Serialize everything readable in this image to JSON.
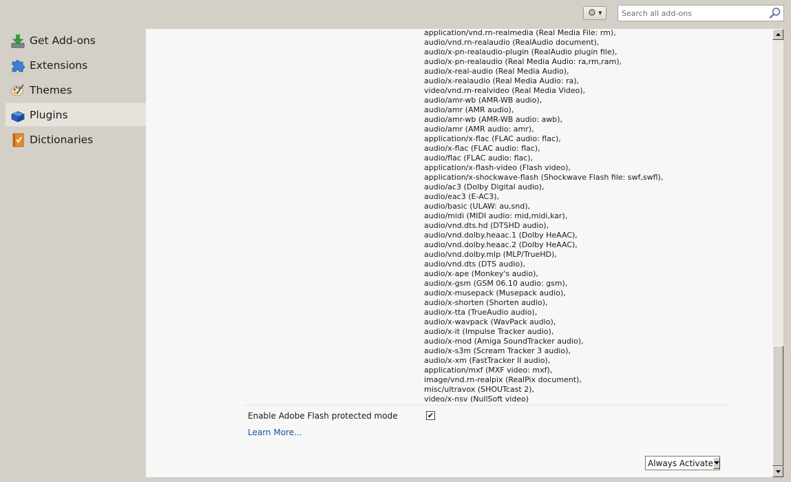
{
  "toolbar": {
    "gear_icon": "gear-icon",
    "search": {
      "placeholder": "Search all add-ons",
      "value": ""
    }
  },
  "sidebar": {
    "items": [
      {
        "label": "Get Add-ons",
        "icon": "get-addons-icon",
        "selected": false
      },
      {
        "label": "Extensions",
        "icon": "puzzle-piece-icon",
        "selected": false
      },
      {
        "label": "Themes",
        "icon": "paintbrush-icon",
        "selected": false
      },
      {
        "label": "Plugins",
        "icon": "plugin-block-icon",
        "selected": true
      },
      {
        "label": "Dictionaries",
        "icon": "dictionary-book-icon",
        "selected": false
      }
    ]
  },
  "plugin_detail": {
    "mime_types": [
      "application/vnd.rn-realmedia (Real Media File: rm),",
      "audio/vnd.rn-realaudio (RealAudio document),",
      "audio/x-pn-realaudio-plugin (RealAudio plugin file),",
      "audio/x-pn-realaudio (Real Media Audio: ra,rm,ram),",
      "audio/x-real-audio (Real Media Audio),",
      "audio/x-realaudio (Real Media Audio: ra),",
      "video/vnd.rn-realvideo (Real Media Video),",
      "audio/amr-wb (AMR-WB audio),",
      "audio/amr (AMR audio),",
      "audio/amr-wb (AMR-WB audio: awb),",
      "audio/amr (AMR audio: amr),",
      "application/x-flac (FLAC audio: flac),",
      "audio/x-flac (FLAC audio: flac),",
      "audio/flac (FLAC audio: flac),",
      "application/x-flash-video (Flash video),",
      "application/x-shockwave-flash (Shockwave Flash file: swf,swfl),",
      "audio/ac3 (Dolby Digital audio),",
      "audio/eac3 (E-AC3),",
      "audio/basic (ULAW: au,snd),",
      "audio/midi (MIDI audio: mid,midi,kar),",
      "audio/vnd.dts.hd (DTSHD audio),",
      "audio/vnd.dolby.heaac.1 (Dolby HeAAC),",
      "audio/vnd.dolby.heaac.2 (Dolby HeAAC),",
      "audio/vnd.dolby.mlp (MLP/TrueHD),",
      "audio/vnd.dts (DTS audio),",
      "audio/x-ape (Monkey's audio),",
      "audio/x-gsm (GSM 06.10 audio: gsm),",
      "audio/x-musepack (Musepack audio),",
      "audio/x-shorten (Shorten audio),",
      "audio/x-tta (TrueAudio audio),",
      "audio/x-wavpack (WavPack audio),",
      "audio/x-it (Impulse Tracker audio),",
      "audio/x-mod (Amiga SoundTracker audio),",
      "audio/x-s3m (Scream Tracker 3 audio),",
      "audio/x-xm (FastTracker II audio),",
      "application/mxf (MXF video: mxf),",
      "image/vnd.rn-realpix (RealPix document),",
      "misc/ultravox (SHOUTcast 2),",
      "video/x-nsv (NullSoft video)"
    ],
    "protected_mode": {
      "label": "Enable Adobe Flash protected mode",
      "checked": true
    },
    "learn_more": "Learn More...",
    "activation": {
      "selected": "Always Activate"
    }
  },
  "colors": {
    "link": "#1a4ea6",
    "panel_bg": "#f7f7f7",
    "chrome_bg": "#d4d0c8"
  }
}
